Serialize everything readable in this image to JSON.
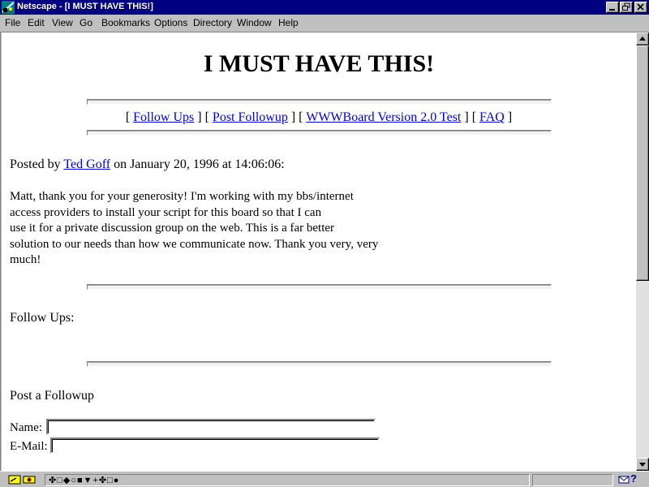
{
  "window": {
    "title": "Netscape - [I MUST HAVE THIS!]",
    "accent_color": "#000080"
  },
  "menu": {
    "items": [
      {
        "label": "File"
      },
      {
        "label": "Edit"
      },
      {
        "label": "View"
      },
      {
        "label": "Go"
      },
      {
        "label": "Bookmarks"
      },
      {
        "label": "Options"
      },
      {
        "label": "Directory"
      },
      {
        "label": "Window"
      },
      {
        "label": "Help"
      }
    ]
  },
  "page": {
    "title": "I MUST HAVE THIS!",
    "nav": {
      "open1": "[ ",
      "follow_ups": "Follow Ups",
      "sep1": " ] [ ",
      "post_followup": "Post Followup",
      "sep2": " ] [ ",
      "wwwboard": "WWWBoard Version 2.0 Test",
      "sep3": " ] [ ",
      "faq": "FAQ",
      "close": " ]"
    },
    "posted": {
      "prefix": "Posted by ",
      "author": "Ted Goff",
      "suffix": " on January 20, 1996 at 14:06:06:"
    },
    "body_lines": [
      "Matt, thank you for your generosity! I'm working with my bbs/internet",
      "access providers to install your script for this board so that I can",
      "use it for a private discussion group on the web. This is a far better",
      "solution to our needs than how we communicate now. Thank you very, very",
      "much!"
    ],
    "follow_ups_heading": "Follow Ups:",
    "post_followup_heading": "Post a Followup",
    "form": {
      "name_label": "Name:",
      "name_value": "",
      "email_label": "E-Mail:",
      "email_value": ""
    },
    "link_color": "#0000ee"
  },
  "statusbar": {
    "text": "✤□◆○■▼+✤□●"
  }
}
